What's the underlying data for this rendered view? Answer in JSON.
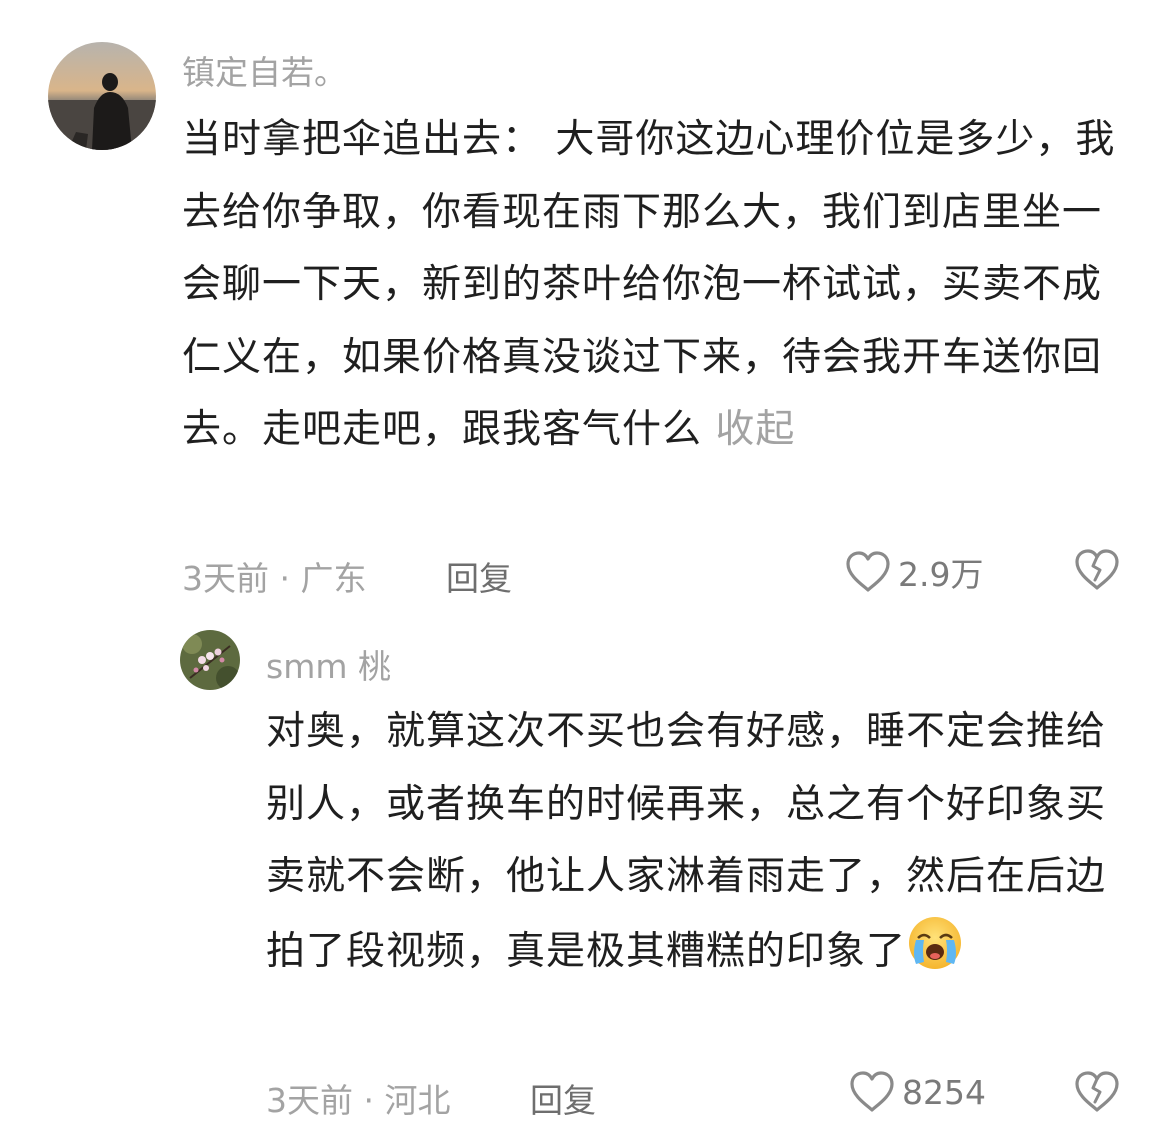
{
  "comments": [
    {
      "username": "镇定自若。",
      "text": "当时拿把伞追出去： 大哥你这边心理价位是多少，我去给你争取，你看现在雨下那么大，我们到店里坐一会聊一下天，新到的茶叶给你泡一杯试试，买卖不成仁义在，如果价格真没谈过下来，待会我开车送你回去。走吧走吧，跟我客气什么",
      "collapse_label": "收起",
      "time": "3天前",
      "separator": "·",
      "location": "广东",
      "reply_label": "回复",
      "like_count": "2.9万",
      "avatar_icon": "sunset-silhouette-avatar"
    },
    {
      "username": "smm 桃",
      "text": "对奥，就算这次不买也会有好感，睡不定会推给别人，或者换车的时候再来，总之有个好印象买卖就不会断，他让人家淋着雨走了，然后在后边拍了段视频，真是极其糟糕的印象了",
      "emoji": "crying-face-emoji",
      "time": "3天前",
      "separator": "·",
      "location": "河北",
      "reply_label": "回复",
      "like_count": "8254",
      "avatar_icon": "blossom-avatar"
    }
  ],
  "colors": {
    "text": "#1f1f1f",
    "muted": "#a3a3a3",
    "icon": "#8a8a8a"
  }
}
